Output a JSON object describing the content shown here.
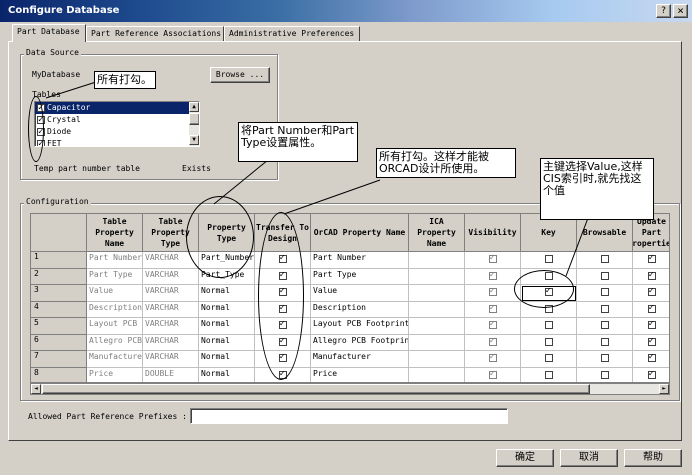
{
  "window": {
    "title": "Configure Database",
    "help_icon": "?",
    "close_icon": "×"
  },
  "tabs": [
    "Part Database",
    "Part Reference Associations",
    "Administrative Preferences"
  ],
  "data_source": {
    "group_label": "Data Source",
    "db_label": "MyDatabase",
    "browse_label": "Browse ...",
    "tables_label": "Tables",
    "tables": [
      {
        "name": "Capacitor",
        "checked": true
      },
      {
        "name": "Crystal",
        "checked": true
      },
      {
        "name": "Diode",
        "checked": true
      },
      {
        "name": "FET",
        "checked": true
      }
    ],
    "temp_table_label": "Temp part number table",
    "exists_label": "Exists"
  },
  "configuration": {
    "group_label": "Configuration",
    "columns": [
      "Table Property Name",
      "Table Property Type",
      "Property Type",
      "Transfer To Design",
      "OrCAD Property Name",
      "ICA Property Name",
      "Visibility",
      "Key",
      "Browsable",
      "Update Part Properties"
    ],
    "rows": [
      {
        "num": "1",
        "tpn": "Part Number",
        "tpt": "VARCHAR",
        "pt": "Part_Number",
        "transfer": true,
        "orcad": "Part Number",
        "ica": "",
        "vis": true,
        "key": false,
        "browse": false,
        "update": true
      },
      {
        "num": "2",
        "tpn": "Part Type",
        "tpt": "VARCHAR",
        "pt": "Part_Type",
        "transfer": true,
        "orcad": "Part Type",
        "ica": "",
        "vis": true,
        "key": false,
        "browse": false,
        "update": true
      },
      {
        "num": "3",
        "tpn": "Value",
        "tpt": "VARCHAR",
        "pt": "Normal",
        "transfer": true,
        "orcad": "Value",
        "ica": "",
        "vis": true,
        "key": true,
        "browse": false,
        "update": true
      },
      {
        "num": "4",
        "tpn": "Description",
        "tpt": "VARCHAR",
        "pt": "Normal",
        "transfer": true,
        "orcad": "Description",
        "ica": "",
        "vis": true,
        "key": false,
        "browse": false,
        "update": true
      },
      {
        "num": "5",
        "tpn": "Layout PCB Footprint",
        "tpt": "VARCHAR",
        "pt": "Normal",
        "transfer": true,
        "orcad": "Layout PCB Footprint",
        "ica": "",
        "vis": true,
        "key": false,
        "browse": false,
        "update": true
      },
      {
        "num": "6",
        "tpn": "Allegro PCB Footprint",
        "tpt": "VARCHAR",
        "pt": "Normal",
        "transfer": true,
        "orcad": "Allegro PCB Footprint",
        "ica": "",
        "vis": true,
        "key": false,
        "browse": false,
        "update": true
      },
      {
        "num": "7",
        "tpn": "Manufacturer",
        "tpt": "VARCHAR",
        "pt": "Normal",
        "transfer": true,
        "orcad": "Manufacturer",
        "ica": "",
        "vis": true,
        "key": false,
        "browse": false,
        "update": true
      },
      {
        "num": "8",
        "tpn": "Price",
        "tpt": "DOUBLE",
        "pt": "Normal",
        "transfer": true,
        "orcad": "Price",
        "ica": "",
        "vis": true,
        "key": false,
        "browse": false,
        "update": true
      }
    ]
  },
  "prefixes_label": "Allowed Part Reference Prefixes :",
  "prefixes_value": "",
  "buttons": {
    "ok": "确定",
    "cancel": "取消",
    "help": "帮助"
  },
  "annotations": {
    "tables_note": "所有打勾。",
    "property_note": "将Part Number和Part Type设置属性。",
    "transfer_note": "所有打勾。这样才能被ORCAD设计所使用。",
    "key_note": "主键选择Value,这样CIS索引时,就先找这个值"
  }
}
